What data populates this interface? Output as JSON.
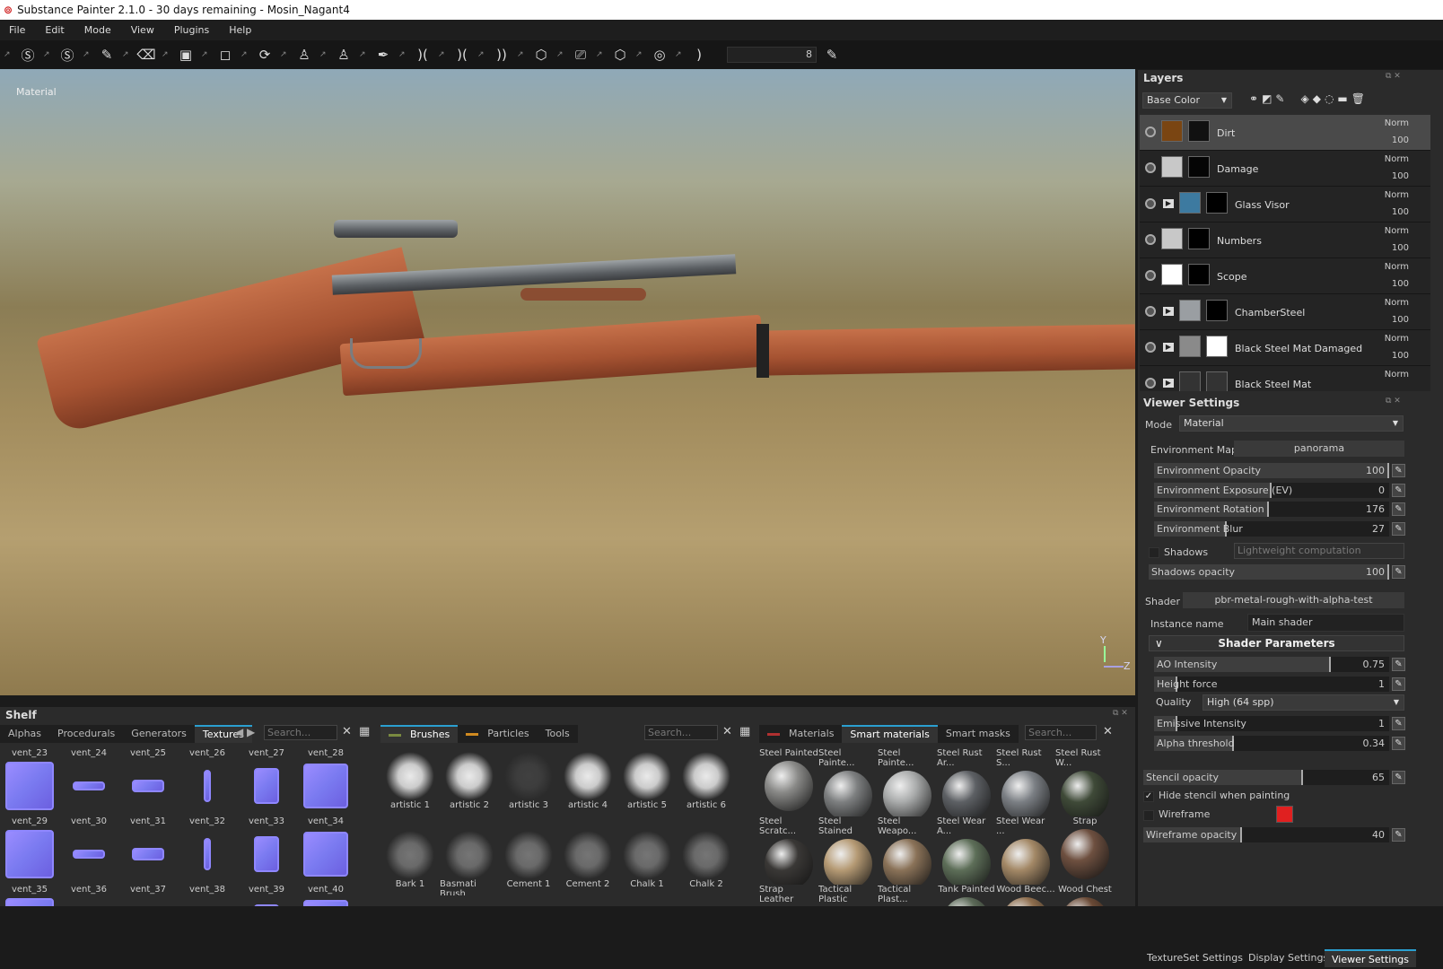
{
  "title": "Substance Painter 2.1.0 - 30 days remaining - Mosin_Nagant4",
  "menu": [
    "File",
    "Edit",
    "Mode",
    "View",
    "Plugins",
    "Help"
  ],
  "toolbar": {
    "brush_size": "8",
    "tools": [
      "substance-share-icon",
      "substance-source-icon",
      "paint-brush-icon",
      "eraser-icon",
      "projection-icon",
      "polygon-fill-icon",
      "smudge-icon",
      "clone-icon",
      "clone-stamp-icon",
      "color-picker-icon",
      "symmetry-icon",
      "symmetry-x-icon",
      "symmetry-mirror-icon",
      "view-3d-icon",
      "camera-icon",
      "cube-icon",
      "screenshot-icon",
      "iray-icon"
    ]
  },
  "viewport": {
    "label": "Material",
    "axis_y": "Y",
    "axis_z": "Z"
  },
  "layers": {
    "title": "Layers",
    "channel": "Base Color",
    "items": [
      {
        "name": "Dirt",
        "blend": "Norm",
        "opacity": "100",
        "color": "#7a4512",
        "mask": "#111",
        "selected": true,
        "folder": false
      },
      {
        "name": "Damage",
        "blend": "Norm",
        "opacity": "100",
        "color": "#c8c8c8",
        "mask": "#050505",
        "folder": false
      },
      {
        "name": "Glass Visor",
        "blend": "Norm",
        "opacity": "100",
        "color": "#3d7aa0",
        "mask": "#000",
        "folder": true
      },
      {
        "name": "Numbers",
        "blend": "Norm",
        "opacity": "100",
        "color": "#c8c8c8",
        "mask": "#000",
        "folder": false
      },
      {
        "name": "Scope",
        "blend": "Norm",
        "opacity": "100",
        "color": "#ffffff",
        "mask": "#000",
        "folder": false
      },
      {
        "name": "ChamberSteel",
        "blend": "Norm",
        "opacity": "100",
        "color": "#9a9ea2",
        "mask": "#000",
        "folder": true
      },
      {
        "name": "Black Steel Mat Damaged",
        "blend": "Norm",
        "opacity": "100",
        "color": "#8a8a8a",
        "mask": "#fff",
        "folder": true
      },
      {
        "name": "Black Steel Mat",
        "blend": "Norm",
        "opacity": "",
        "color": "#333",
        "mask": "#333",
        "folder": true
      }
    ]
  },
  "viewer": {
    "title": "Viewer Settings",
    "mode_label": "Mode",
    "mode": "Material",
    "env_map_label": "Environment Map",
    "env_map": "panorama",
    "env_sliders": [
      {
        "label": "Environment Opacity",
        "value": "100",
        "fill": 1.0
      },
      {
        "label": "Environment Exposure (EV)",
        "value": "0",
        "fill": 0.5
      },
      {
        "label": "Environment Rotation",
        "value": "176",
        "fill": 0.49
      },
      {
        "label": "Environment Blur",
        "value": "27",
        "fill": 0.31
      }
    ],
    "shadows_label": "Shadows",
    "shadows_checked": false,
    "shadows_mode": "Lightweight computation",
    "shadows_opacity": {
      "label": "Shadows opacity",
      "value": "100",
      "fill": 1.0
    },
    "shader_label": "Shader",
    "shader": "pbr-metal-rough-with-alpha-test",
    "instance_label": "Instance name",
    "instance": "Main shader",
    "params_title": "Shader Parameters",
    "params": [
      {
        "label": "AO Intensity",
        "value": "0.75",
        "fill": 0.75
      },
      {
        "label": "Height force",
        "value": "1",
        "fill": 0.1
      }
    ],
    "quality_label": "Quality",
    "quality": "High (64 spp)",
    "params2": [
      {
        "label": "Emissive Intensity",
        "value": "1",
        "fill": 0.1
      },
      {
        "label": "Alpha threshold",
        "value": "0.34",
        "fill": 0.34
      }
    ],
    "stencil": {
      "label": "Stencil opacity",
      "value": "65",
      "fill": 0.65
    },
    "hide_stencil": "Hide stencil when painting",
    "hide_stencil_checked": true,
    "wireframe": "Wireframe",
    "wireframe_checked": false,
    "wireframe_color": "#e02020",
    "wire_opacity": {
      "label": "Wireframe opacity",
      "value": "40",
      "fill": 0.4
    }
  },
  "bottom_tabs": [
    "TextureSet Settings",
    "Display Settings",
    "Viewer Settings"
  ],
  "shelf": {
    "title": "Shelf",
    "left": {
      "tabs": [
        "Alphas",
        "Procedurals",
        "Generators",
        "Textures"
      ],
      "active": 3,
      "search": "Search...",
      "items": [
        "vent_23",
        "vent_24",
        "vent_25",
        "vent_26",
        "vent_27",
        "vent_28",
        "vent_29",
        "vent_30",
        "vent_31",
        "vent_32",
        "vent_33",
        "vent_34",
        "vent_35",
        "vent_36",
        "vent_37",
        "vent_38",
        "vent_39",
        "vent_40"
      ]
    },
    "mid": {
      "tabs": [
        "Brushes",
        "Particles",
        "Tools"
      ],
      "active": 0,
      "search": "Search...",
      "items": [
        "artistic 1",
        "artistic 2",
        "artistic 3",
        "artistic 4",
        "artistic 5",
        "artistic 6",
        "Bark 1",
        "Basmati Brush",
        "Cement 1",
        "Cement 2",
        "Chalk 1",
        "Chalk 2"
      ]
    },
    "right": {
      "tabs": [
        "Materials",
        "Smart materials",
        "Smart masks"
      ],
      "active": 1,
      "search": "Search...",
      "items": [
        "Steel Painted",
        "Steel Painte...",
        "Steel Painte...",
        "Steel Rust Ar...",
        "Steel Rust S...",
        "Steel Rust W...",
        "Steel Scratc...",
        "Steel Stained",
        "Steel Weapo...",
        "Steel Wear A...",
        "Steel Wear ...",
        "Strap",
        "Strap Leather",
        "Tactical Plastic",
        "Tactical Plast...",
        "Tank Painted",
        "Wood Beec...",
        "Wood Chest"
      ],
      "colors": [
        "#8a8a88",
        "#7d7f80",
        "#a9abab",
        "#5d6064",
        "#7b7f84",
        "#3f4a38",
        "#3a3836",
        "#b59a74",
        "#8a7258",
        "#5d6e58",
        "#a38866",
        "#6e5040",
        "#444",
        "#b8a07c",
        "#98805e",
        "#5c6a58",
        "#8e6e4e",
        "#6a4a36"
      ]
    }
  }
}
